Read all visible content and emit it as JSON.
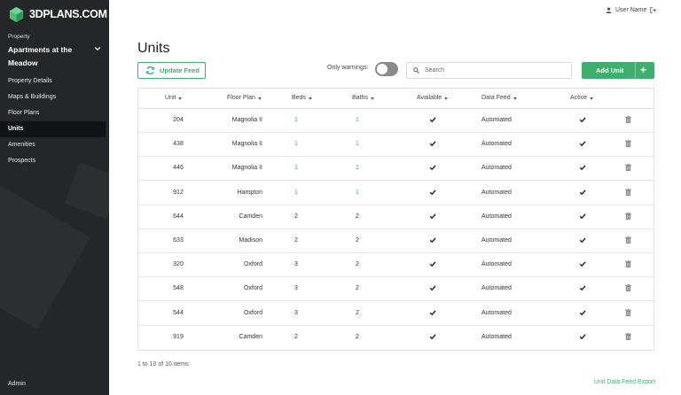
{
  "brand": {
    "logo_text": "3DPLANS.COM",
    "logo_icon": "cube-logo-icon",
    "accent": "#3fae6f"
  },
  "sidebar": {
    "property_label": "Property",
    "property_name": "Apartments at the Meadow",
    "items": [
      {
        "label": "Property Details",
        "active": false
      },
      {
        "label": "Maps & Buildings",
        "active": false
      },
      {
        "label": "Floor Plans",
        "active": false
      },
      {
        "label": "Units",
        "active": true
      },
      {
        "label": "Amenities",
        "active": false
      },
      {
        "label": "Prospects",
        "active": false
      }
    ],
    "admin": "Admin"
  },
  "header": {
    "user_name": "User Name",
    "user_icon": "user-icon",
    "logout_icon": "logout-icon"
  },
  "page": {
    "title": "Units",
    "update_feed_label": "Update Feed",
    "only_warnings_label": "Only warnings:",
    "only_warnings_on": false,
    "search_placeholder": "Search",
    "add_unit_label": "Add Unit",
    "add_unit_icon": "+"
  },
  "table": {
    "columns": [
      "Unit",
      "Floor Plan",
      "Beds",
      "Baths",
      "Available",
      "Data Feed",
      "Active"
    ],
    "rows": [
      {
        "unit": "204",
        "plan": "Magnolia II",
        "beds": "1",
        "baths": "1",
        "feed": "Automated"
      },
      {
        "unit": "438",
        "plan": "Magnolia II",
        "beds": "1",
        "baths": "1",
        "feed": "Automated"
      },
      {
        "unit": "446",
        "plan": "Magnolia II",
        "beds": "1",
        "baths": "1",
        "feed": "Automated"
      },
      {
        "unit": "912",
        "plan": "Hampton",
        "beds": "1",
        "baths": "1",
        "feed": "Automated"
      },
      {
        "unit": "644",
        "plan": "Camden",
        "beds": "2",
        "baths": "2",
        "feed": "Automated"
      },
      {
        "unit": "633",
        "plan": "Madison",
        "beds": "2",
        "baths": "2",
        "feed": "Automated"
      },
      {
        "unit": "320",
        "plan": "Oxford",
        "beds": "3",
        "baths": "2",
        "feed": "Automated"
      },
      {
        "unit": "548",
        "plan": "Oxford",
        "beds": "3",
        "baths": "2",
        "feed": "Automated"
      },
      {
        "unit": "544",
        "plan": "Oxford",
        "beds": "3",
        "baths": "2",
        "feed": "Automated"
      },
      {
        "unit": "919",
        "plan": "Camden",
        "beds": "2",
        "baths": "2",
        "feed": "Automated"
      }
    ]
  },
  "footer": {
    "count_text": "1 to 10 of 10 items",
    "export_label": "Unit Data Feed Export"
  }
}
